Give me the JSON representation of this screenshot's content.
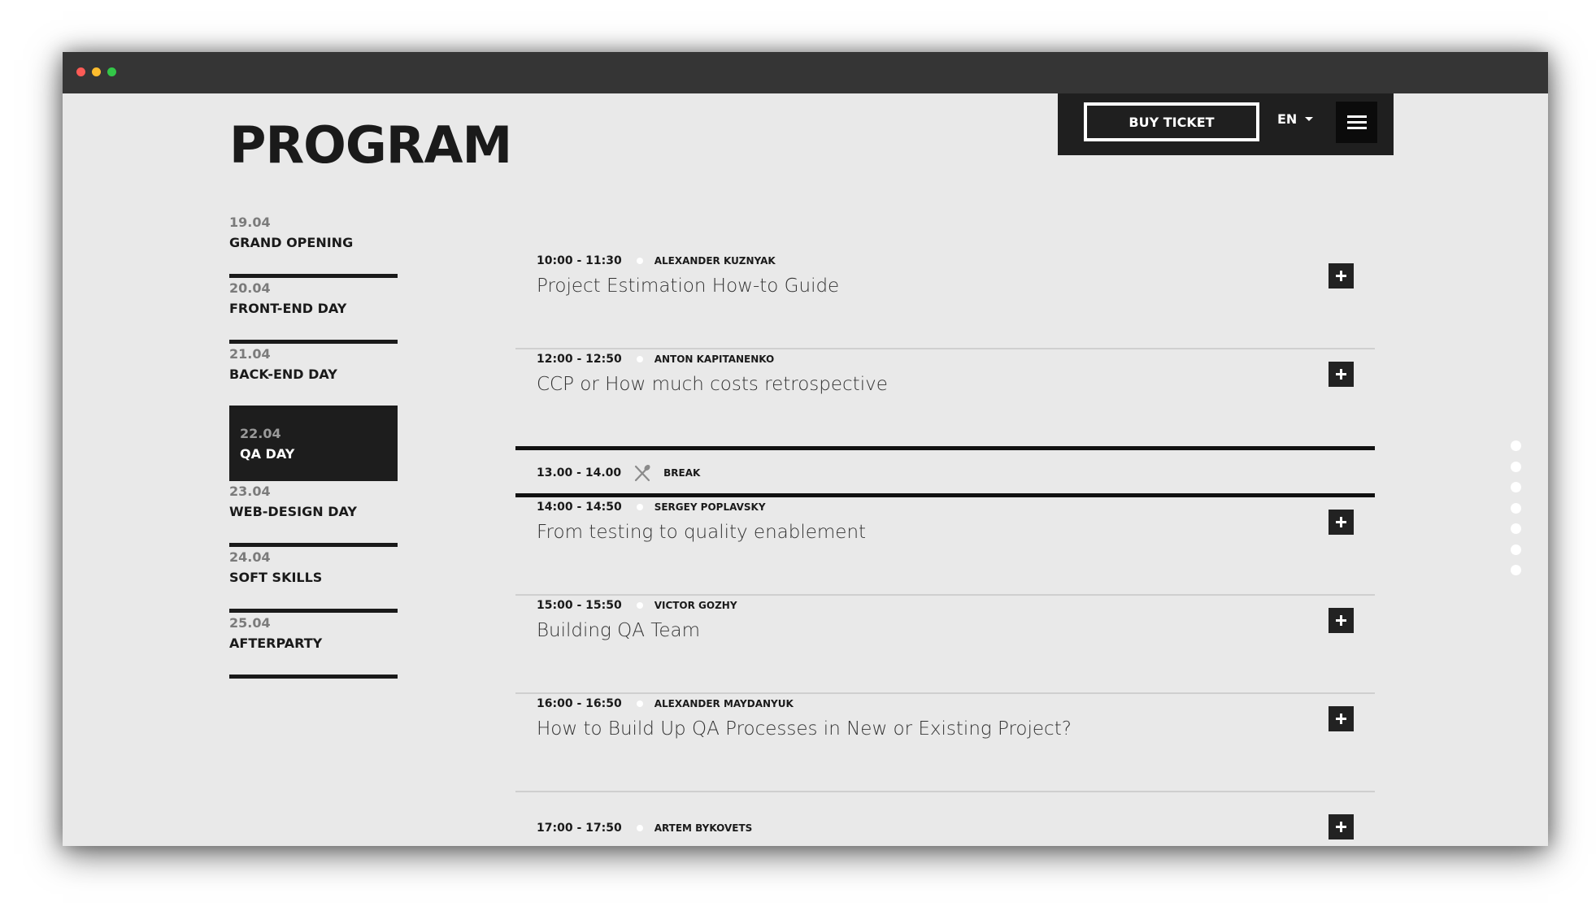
{
  "page": {
    "title": "PROGRAM"
  },
  "header": {
    "buy_ticket_label": "BUY TICKET",
    "language": "EN"
  },
  "days": [
    {
      "date": "19.04",
      "name": "GRAND OPENING"
    },
    {
      "date": "20.04",
      "name": "FRONT-END DAY"
    },
    {
      "date": "21.04",
      "name": "BACK-END DAY"
    },
    {
      "date": "22.04",
      "name": "QA DAY",
      "active": true
    },
    {
      "date": "23.04",
      "name": "WEB-DESIGN DAY"
    },
    {
      "date": "24.04",
      "name": "SOFT SKILLS"
    },
    {
      "date": "25.04",
      "name": "AFTERPARTY"
    }
  ],
  "sessions": [
    {
      "time": "10:00 - 11:30",
      "speaker": "ALEXANDER KUZNYAK",
      "title": "Project Estimation How-to Guide"
    },
    {
      "time": "12:00 - 12:50",
      "speaker": "ANTON KAPITANENKO",
      "title": "CCP or How much costs retrospective"
    },
    {
      "time": "13.00 - 14.00",
      "label": "BREAK",
      "icon": "cutlery-icon"
    },
    {
      "time": "14:00 - 14:50",
      "speaker": "SERGEY POPLAVSKY",
      "title": "From testing to quality enablement"
    },
    {
      "time": "15:00 - 15:50",
      "speaker": "VICTOR GOZHY",
      "title": "Building QA Team"
    },
    {
      "time": "16:00 - 16:50",
      "speaker": "ALEXANDER MAYDANYUK",
      "title": "How to Build Up QA Processes in New or Existing Project?"
    },
    {
      "time": "17:00 - 17:50",
      "speaker": "ARTEM BYKOVETS",
      "title": ""
    }
  ],
  "scroll_indicator": {
    "count": 7
  },
  "colors": {
    "window_bg": "#e9e9e9",
    "dark": "#1d1d1d",
    "titlebar": "#353535",
    "accent": "#ffffff"
  }
}
